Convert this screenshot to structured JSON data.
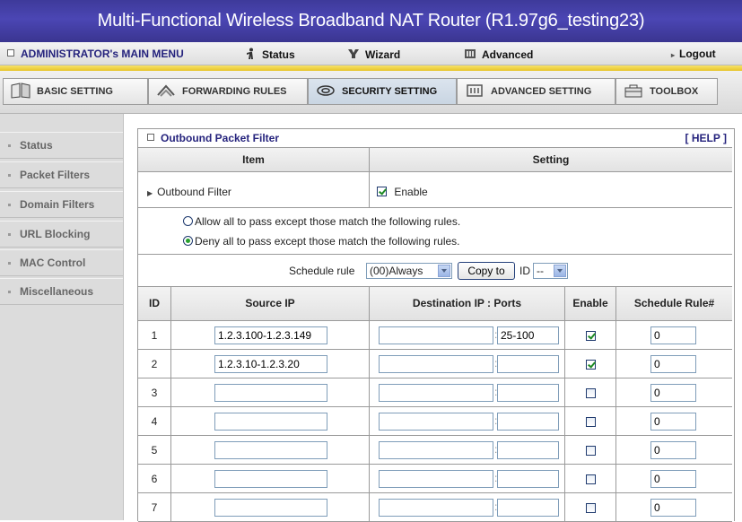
{
  "title": "Multi-Functional Wireless Broadband NAT Router (R1.97g6_testing23)",
  "menu": {
    "admin": "ADMINISTRATOR's MAIN MENU",
    "status": "Status",
    "wizard": "Wizard",
    "advanced": "Advanced",
    "logout": "Logout"
  },
  "tabs": {
    "basic": "BASIC SETTING",
    "forwarding": "FORWARDING RULES",
    "security": "SECURITY SETTING",
    "advanced": "ADVANCED SETTING",
    "toolbox": "TOOLBOX"
  },
  "sidebar": {
    "items": [
      "Status",
      "Packet Filters",
      "Domain Filters",
      "URL Blocking",
      "MAC Control",
      "Miscellaneous"
    ]
  },
  "panel": {
    "title": "Outbound Packet Filter",
    "help": "[ HELP ]",
    "col_item": "Item",
    "col_setting": "Setting",
    "outbound_filter_label": "Outbound Filter",
    "enable_label": "Enable",
    "outbound_filter_enabled": true,
    "radio_allow": "Allow all to pass except those match the following rules.",
    "radio_deny": "Deny all to pass except those match the following rules.",
    "selected_policy": "deny",
    "schedule_label": "Schedule rule",
    "schedule_value": "(00)Always",
    "copy_button": "Copy to",
    "id_label": "ID",
    "id_value": "--"
  },
  "rules": {
    "headers": {
      "id": "ID",
      "source": "Source IP",
      "destination": "Destination IP : Ports",
      "enable": "Enable",
      "schedule": "Schedule Rule#"
    },
    "rows": [
      {
        "id": "1",
        "source": "1.2.3.100-1.2.3.149",
        "dest_ip": "",
        "ports": "25-100",
        "enabled": true,
        "schedule": "0"
      },
      {
        "id": "2",
        "source": "1.2.3.10-1.2.3.20",
        "dest_ip": "",
        "ports": "",
        "enabled": true,
        "schedule": "0"
      },
      {
        "id": "3",
        "source": "",
        "dest_ip": "",
        "ports": "",
        "enabled": false,
        "schedule": "0"
      },
      {
        "id": "4",
        "source": "",
        "dest_ip": "",
        "ports": "",
        "enabled": false,
        "schedule": "0"
      },
      {
        "id": "5",
        "source": "",
        "dest_ip": "",
        "ports": "",
        "enabled": false,
        "schedule": "0"
      },
      {
        "id": "6",
        "source": "",
        "dest_ip": "",
        "ports": "",
        "enabled": false,
        "schedule": "0"
      },
      {
        "id": "7",
        "source": "",
        "dest_ip": "",
        "ports": "",
        "enabled": false,
        "schedule": "0"
      }
    ]
  },
  "colors": {
    "title_bar": "#4541a8",
    "accent_text": "#25237d",
    "stripe": "#f0d54a",
    "check": "#1d8a24"
  }
}
